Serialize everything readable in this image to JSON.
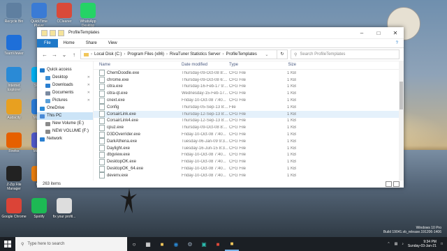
{
  "desktop": {
    "icons": [
      {
        "label": "Recycle Bin",
        "icon": "recycle-bin-icon",
        "color": "#5f7fa0"
      },
      {
        "label": "QuickTime Player",
        "icon": "quicktime-icon",
        "color": "#3a7bd5"
      },
      {
        "label": "CCleaner",
        "icon": "ccleaner-icon",
        "color": "#d94a3a"
      },
      {
        "label": "WhatsApp Desktop",
        "icon": "whatsapp-icon",
        "color": "#25d366"
      },
      {
        "label": "TeamViewer",
        "icon": "teamviewer-icon",
        "color": "#1e6fd9"
      },
      {
        "label": "Internet Explorer",
        "icon": "ie-icon",
        "color": "#2a8ad6"
      },
      {
        "label": "Skype",
        "icon": "skype-icon",
        "color": "#00aff0"
      },
      {
        "label": "Audacity",
        "icon": "audacity-icon",
        "color": "#e8a020"
      },
      {
        "label": "Micro...",
        "icon": "edge-icon",
        "color": "#2a7bd6"
      },
      {
        "label": "Firefox",
        "icon": "firefox-icon",
        "color": "#e66000"
      },
      {
        "label": "Micro...",
        "icon": "teams-icon",
        "color": "#5059c9"
      },
      {
        "label": "Z-Zip File Manager",
        "icon": "7zip-icon",
        "color": "#222222"
      },
      {
        "label": "Bl...",
        "icon": "blender-icon",
        "color": "#e87d0d"
      },
      {
        "label": "Google Chrome",
        "icon": "chrome-icon",
        "color": "#db4437"
      },
      {
        "label": "Spotify",
        "icon": "spotify-icon",
        "color": "#1db954"
      },
      {
        "label": "fix your profil...",
        "icon": "document-icon",
        "color": "#dddddd"
      }
    ]
  },
  "window": {
    "title": "ProfileTemplates",
    "ribbon_tabs": [
      "File",
      "Home",
      "Share",
      "View"
    ],
    "breadcrumb": [
      "Local Disk (C:)",
      "Program Files (x86)",
      "RivaTuner Statistics Server",
      "ProfileTemplates"
    ],
    "search_placeholder": "Search ProfileTemplates",
    "nav": [
      {
        "label": "Quick access",
        "pinned": false
      },
      {
        "label": "Desktop",
        "pinned": true
      },
      {
        "label": "Downloads",
        "pinned": true
      },
      {
        "label": "Documents",
        "pinned": true
      },
      {
        "label": "Pictures",
        "pinned": true
      },
      {
        "label": "OneDrive",
        "pinned": false
      },
      {
        "label": "This PC",
        "pinned": false
      },
      {
        "label": "New Volume (E:)",
        "pinned": false
      },
      {
        "label": "NEW VOLUME (F:)",
        "pinned": false
      },
      {
        "label": "Network",
        "pinned": false
      }
    ],
    "columns": {
      "name": "Name",
      "date": "Date modified",
      "type": "Type",
      "size": "Size"
    },
    "files": [
      {
        "name": "ChemDoodle.exe",
        "date": "Thursday-09-Oct-08 8:...",
        "type": "CFG File",
        "size": "1 KB"
      },
      {
        "name": "chrome.exe",
        "date": "Thursday-09-Oct-08 6:...",
        "type": "CFG File",
        "size": "1 KB"
      },
      {
        "name": "citra.exe",
        "date": "Thursday-16-Feb-17 9:...",
        "type": "CFG File",
        "size": "1 KB"
      },
      {
        "name": "citra-qt.exe",
        "date": "Wednesday-15-Feb-17...",
        "type": "CFG File",
        "size": "1 KB"
      },
      {
        "name": "cnext.exe",
        "date": "Friday-10-Oct-08 7:40...",
        "type": "CFG File",
        "size": "1 KB"
      },
      {
        "name": "Config",
        "date": "Thursday-05-Sep-13 8:...",
        "type": "File",
        "size": "1 KB"
      },
      {
        "name": "CorsairLink.exe",
        "date": "Thursday-12-Sep-13 8:...",
        "type": "CFG File",
        "size": "1 KB"
      },
      {
        "name": "CorsairLink4.exe",
        "date": "Thursday-12-Sep-13 8:...",
        "type": "CFG File",
        "size": "1 KB"
      },
      {
        "name": "cpuz.exe",
        "date": "Thursday-09-Oct-08 8:...",
        "type": "CFG File",
        "size": "1 KB"
      },
      {
        "name": "D3DOverrider.exe",
        "date": "Friday-10-Oct-08 7:40...",
        "type": "CFG File",
        "size": "1 KB"
      },
      {
        "name": "DarkAthena.exe",
        "date": "Tuesday-06-Jan-09 9:3...",
        "type": "CFG File",
        "size": "1 KB"
      },
      {
        "name": "Daylight.exe",
        "date": "Tuesday-16-Jun-15 8:3...",
        "type": "CFG File",
        "size": "1 KB"
      },
      {
        "name": "dbgview.exe",
        "date": "Friday-10-Oct-08 7:40...",
        "type": "CFG File",
        "size": "1 KB"
      },
      {
        "name": "DesktopOK.exe",
        "date": "Friday-10-Oct-08 7:40...",
        "type": "CFG File",
        "size": "1 KB"
      },
      {
        "name": "DesktopOK_64.exe",
        "date": "Friday-10-Oct-08 7:40...",
        "type": "CFG File",
        "size": "1 KB"
      },
      {
        "name": "devenv.exe",
        "date": "Friday-10-Oct-08 7:40...",
        "type": "CFG File",
        "size": "1 KB"
      }
    ],
    "highlighted_index": 6,
    "status_items": "263 items"
  },
  "taskbar": {
    "search_placeholder": "Type here to search",
    "apps": [
      "file-explorer-icon",
      "edge-icon",
      "steam-icon",
      "store-icon",
      "game-icon",
      "explorer-folder-icon"
    ],
    "time": "9:34 PM",
    "date": "Sunday-03-Jan-21"
  },
  "watermark": {
    "line1": "Windows 10 Pro",
    "line2": "Build 19041.vb_release.191206-1406"
  },
  "colors": {
    "accent": "#1e78c8",
    "selection": "#cce4f7",
    "taskbar": "#1b1f24"
  }
}
